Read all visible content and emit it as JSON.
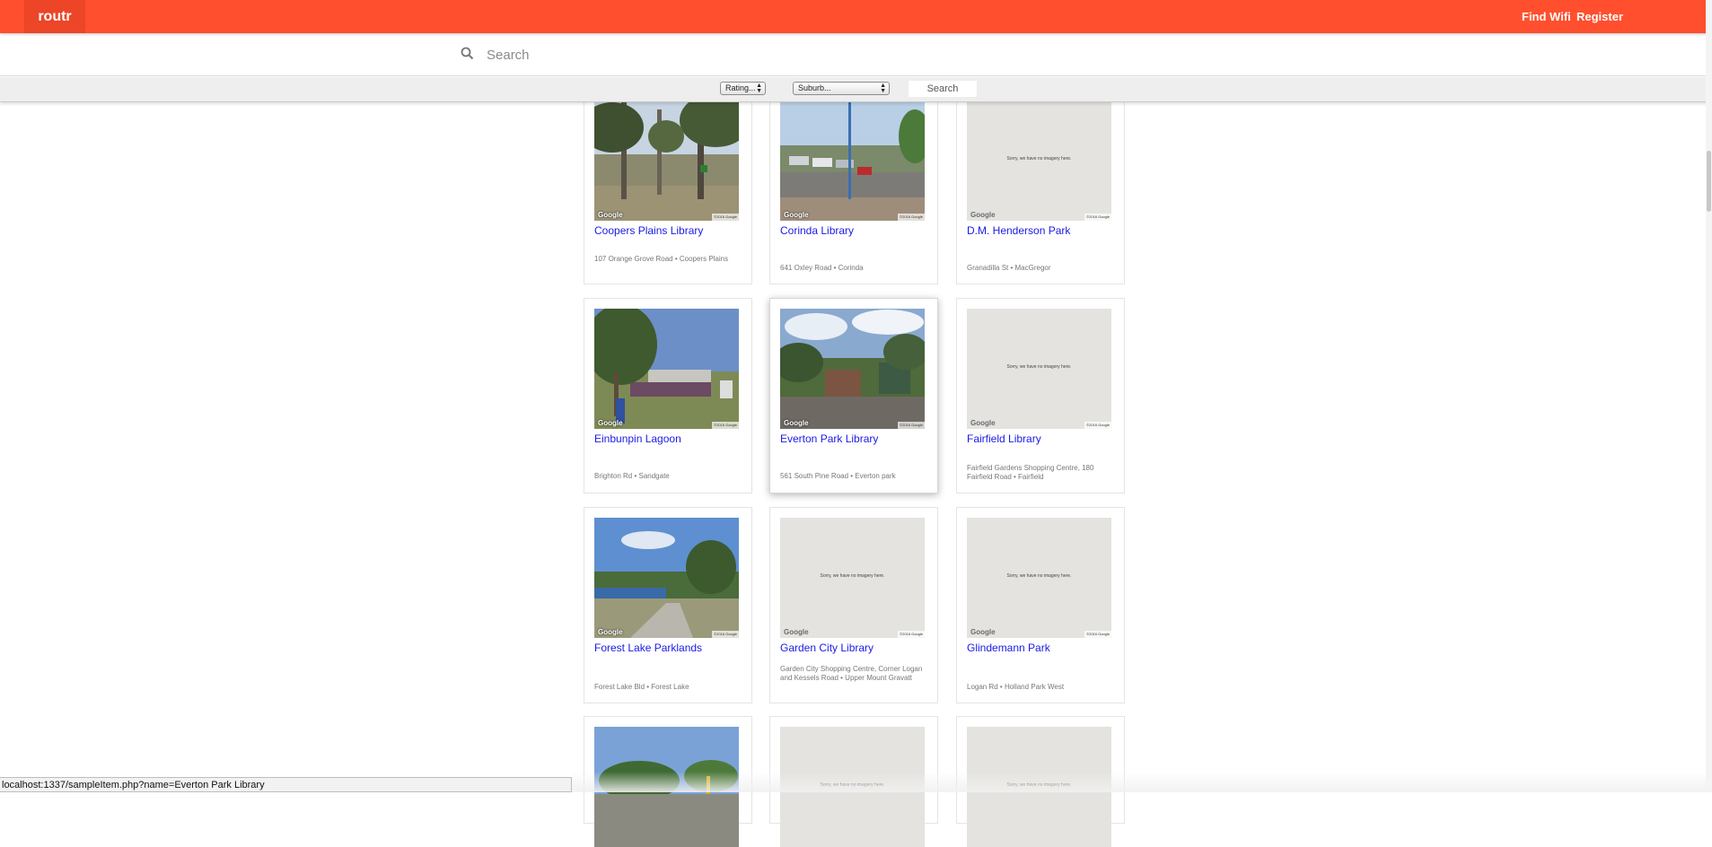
{
  "brand": {
    "logo": "routr",
    "color": "#ff4f2e"
  },
  "nav": {
    "find_wifi": "Find Wifi",
    "register": "Register"
  },
  "search": {
    "placeholder": "Search",
    "icon": "search-icon"
  },
  "filters": {
    "rating": "Rating...",
    "suburb": "Suburb...",
    "search_button": "Search"
  },
  "cards": [
    {
      "title": "Coopers Plains Library",
      "address": "107 Orange Grove Road • Coopers Plains",
      "image": "photo-park"
    },
    {
      "title": "Corinda Library",
      "address": "641 Oxley Road • Corinda",
      "image": "photo-street"
    },
    {
      "title": "D.M. Henderson Park",
      "address": "Granadilla St • MacGregor",
      "image": "no-imagery"
    },
    {
      "title": "Einbunpin Lagoon",
      "address": "Brighton Rd • Sandgate",
      "image": "photo-crowd"
    },
    {
      "title": "Everton Park Library",
      "address": "561 South Pine Road • Everton park",
      "image": "photo-building"
    },
    {
      "title": "Fairfield Library",
      "address": "Fairfield Gardens Shopping Centre, 180 Fairfield Road • Fairfield",
      "image": "no-imagery"
    },
    {
      "title": "Forest Lake Parklands",
      "address": "Forest Lake Bld • Forest Lake",
      "image": "photo-lake"
    },
    {
      "title": "Garden City Library",
      "address": "Garden City Shopping Centre, Corner Logan and Kessels Road • Upper Mount Gravatt",
      "image": "no-imagery"
    },
    {
      "title": "Glindemann Park",
      "address": "Logan Rd • Holland Park West",
      "image": "no-imagery"
    },
    {
      "title": "",
      "address": "",
      "image": "photo-road"
    },
    {
      "title": "",
      "address": "",
      "image": "no-imagery"
    },
    {
      "title": "",
      "address": "",
      "image": "no-imagery"
    }
  ],
  "imagery": {
    "no_imagery_text": "Sorry, we have no imagery here.",
    "google": "Google",
    "copyright": "©2016 Google"
  },
  "status_bar": "localhost:1337/sampleItem.php?name=Everton Park Library"
}
